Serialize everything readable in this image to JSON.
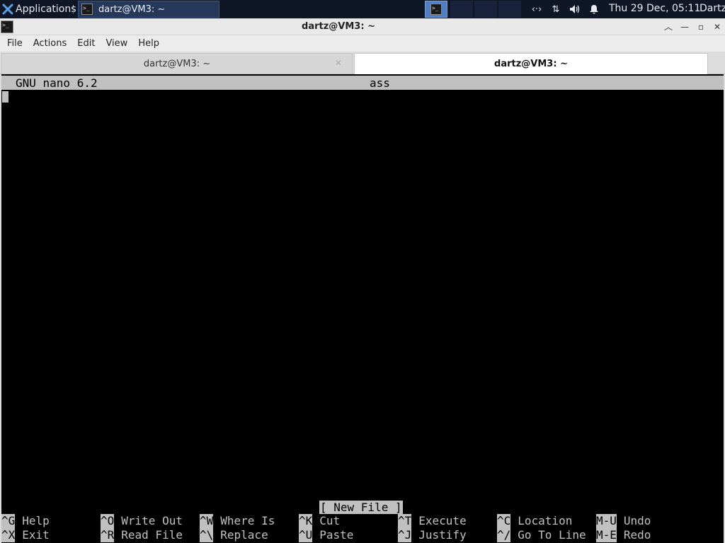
{
  "panel": {
    "applications_label": "Applications",
    "taskbar_window": "dartz@VM3: ~",
    "clock": "Thu 29 Dec, 05:11",
    "user": "Dartz"
  },
  "window": {
    "title": "dartz@VM3: ~"
  },
  "menu": {
    "file": "File",
    "actions": "Actions",
    "edit": "Edit",
    "view": "View",
    "help": "Help"
  },
  "tabs": [
    {
      "label": "dartz@VM3: ~",
      "active": false
    },
    {
      "label": "dartz@VM3: ~",
      "active": true
    }
  ],
  "nano": {
    "version": "GNU nano 6.2",
    "filename": "ass",
    "status": "[ New File ]",
    "shortcuts_row1": [
      {
        "key": "^G",
        "label": "Help"
      },
      {
        "key": "^O",
        "label": "Write Out"
      },
      {
        "key": "^W",
        "label": "Where Is"
      },
      {
        "key": "^K",
        "label": "Cut"
      },
      {
        "key": "^T",
        "label": "Execute"
      },
      {
        "key": "^C",
        "label": "Location"
      },
      {
        "key": "M-U",
        "label": "Undo"
      }
    ],
    "shortcuts_row2": [
      {
        "key": "^X",
        "label": "Exit"
      },
      {
        "key": "^R",
        "label": "Read File"
      },
      {
        "key": "^\\",
        "label": "Replace"
      },
      {
        "key": "^U",
        "label": "Paste"
      },
      {
        "key": "^J",
        "label": "Justify"
      },
      {
        "key": "^/",
        "label": "Go To Line"
      },
      {
        "key": "M-E",
        "label": "Redo"
      }
    ]
  },
  "colors": {
    "panel_bg": "#0f1727",
    "terminal_bg": "#000000",
    "nano_bar": "#c0c0c0",
    "active_workspace": "#4f7ec2"
  }
}
